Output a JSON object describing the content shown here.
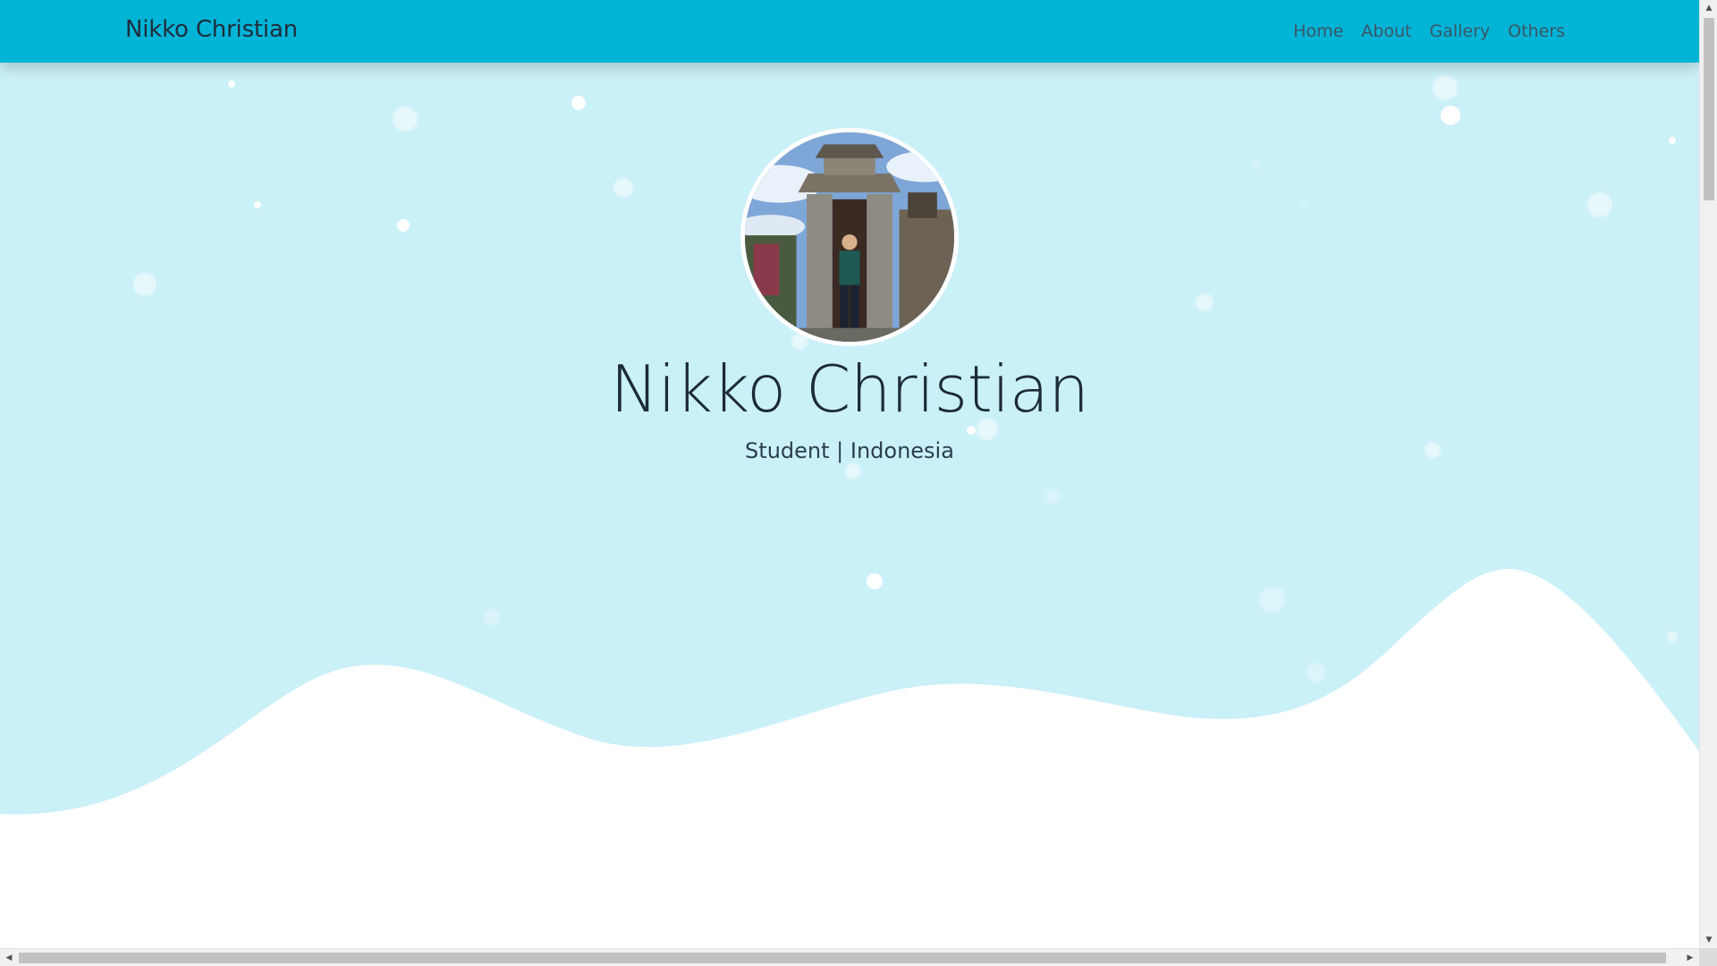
{
  "navbar": {
    "brand": "Nikko Christian",
    "links": [
      {
        "label": "Home"
      },
      {
        "label": "About"
      },
      {
        "label": "Gallery"
      },
      {
        "label": "Others"
      }
    ],
    "background_color": "#00b4d8"
  },
  "hero": {
    "title": "Nikko Christian",
    "subtitle": "Student | Indonesia",
    "background_color": "#caf0f8",
    "wave_color": "#ffffff",
    "avatar": {
      "icon": "profile-photo"
    }
  },
  "scrollbars": {
    "up_arrow": "▲",
    "down_arrow": "▼",
    "left_arrow": "◀",
    "right_arrow": "▶"
  }
}
